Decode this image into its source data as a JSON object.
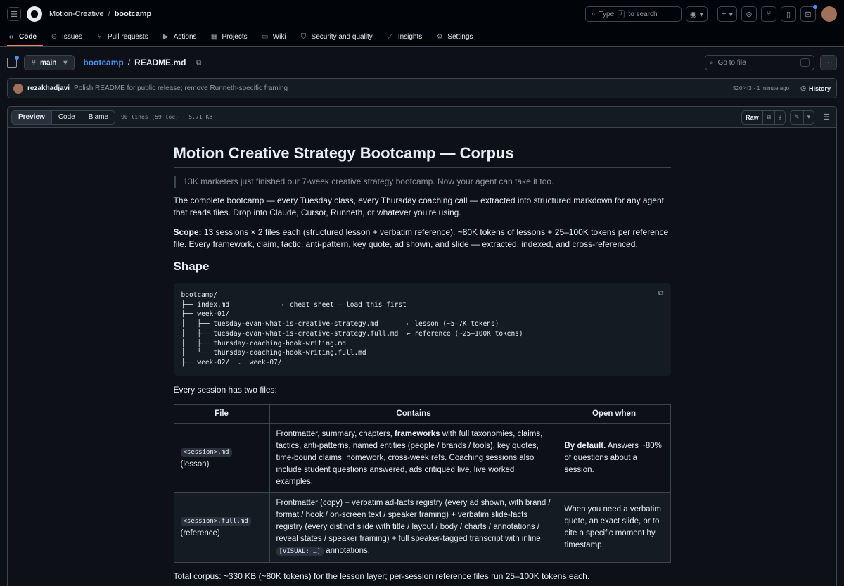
{
  "header": {
    "owner": "Motion-Creative",
    "separator": "/",
    "repo": "bootcamp",
    "search_prefix": "Type",
    "search_key": "/",
    "search_suffix": "to search"
  },
  "nav": {
    "tabs": [
      {
        "label": "Code",
        "icon": "code-icon"
      },
      {
        "label": "Issues",
        "icon": "issue-icon"
      },
      {
        "label": "Pull requests",
        "icon": "pull-request-icon"
      },
      {
        "label": "Actions",
        "icon": "play-icon"
      },
      {
        "label": "Projects",
        "icon": "table-icon"
      },
      {
        "label": "Wiki",
        "icon": "book-icon"
      },
      {
        "label": "Security and quality",
        "icon": "shield-icon"
      },
      {
        "label": "Insights",
        "icon": "graph-icon"
      },
      {
        "label": "Settings",
        "icon": "gear-icon"
      }
    ]
  },
  "filebar": {
    "branch": "main",
    "path_repo": "bootcamp",
    "path_sep": "/",
    "path_file": "README.md",
    "goto_placeholder": "Go to file",
    "goto_key": "T"
  },
  "commit": {
    "author": "rezakhadjavi",
    "message": "Polish README for public release; remove Runneth-specific framing",
    "meta": "520f4f3 · 1 minute ago",
    "history_label": "History"
  },
  "viewer": {
    "tabs": [
      "Preview",
      "Code",
      "Blame"
    ],
    "meta": "90 lines (59 loc) · 5.71 KB",
    "raw_label": "Raw"
  },
  "readme": {
    "title": "Motion Creative Strategy Bootcamp — Corpus",
    "quote": "13K marketers just finished our 7-week creative strategy bootcamp. Now your agent can take it too.",
    "intro": "The complete bootcamp — every Tuesday class, every Thursday coaching call — extracted into structured markdown for any agent that reads files. Drop into Claude, Cursor, Runneth, or whatever you're using.",
    "scope_label": "Scope:",
    "scope_text": " 13 sessions × 2 files each (structured lesson + verbatim reference). ~80K tokens of lessons + 25–100K tokens per reference file. Every framework, claim, tactic, anti-pattern, key quote, ad shown, and slide — extracted, indexed, and cross-referenced.",
    "shape_heading": "Shape",
    "tree": "bootcamp/\n├── index.md             ← cheat sheet — load this first\n├── week-01/\n│   ├── tuesday-evan-what-is-creative-strategy.md       ← lesson (~5–7K tokens)\n│   ├── tuesday-evan-what-is-creative-strategy.full.md  ← reference (~25–100K tokens)\n│   ├── thursday-coaching-hook-writing.md\n│   └── thursday-coaching-hook-writing.full.md\n├── week-02/  …  week-07/",
    "files_intro": "Every session has two files:",
    "table": {
      "headers": [
        "File",
        "Contains",
        "Open when"
      ],
      "rows": [
        {
          "file_code": "<session>.md",
          "file_label": "(lesson)",
          "contains_a": "Frontmatter, summary, chapters, ",
          "contains_bold": "frameworks",
          "contains_b": " with full taxonomies, claims, tactics, anti-patterns, named entities (people / brands / tools), key quotes, time-bound claims, homework, cross-week refs. Coaching sessions also include student questions answered, ads critiqued live, live worked examples.",
          "open_bold": "By default.",
          "open_text": " Answers ~80% of questions about a session."
        },
        {
          "file_code": "<session>.full.md",
          "file_label": "(reference)",
          "contains_a": "Frontmatter (copy) + verbatim ad-facts registry (every ad shown, with brand / format / hook / on-screen text / speaker framing) + verbatim slide-facts registry (every distinct slide with title / layout / body / charts / annotations / reveal states / speaker framing) + full speaker-tagged transcript with inline ",
          "contains_code": "[VISUAL: …]",
          "contains_b": " annotations.",
          "open_text": "When you need a verbatim quote, an exact slide, or to cite a specific moment by timestamp."
        }
      ]
    },
    "total": "Total corpus: ~330 KB (~80K tokens) for the lesson layer; per-session reference files run 25–100K tokens each."
  }
}
